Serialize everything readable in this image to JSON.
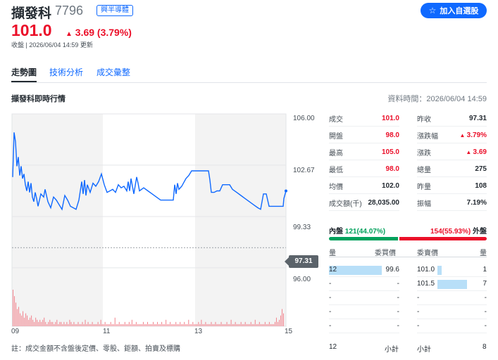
{
  "header": {
    "name": "擷發科",
    "code": "7796",
    "tag": "興半導體",
    "watchlist_label": "加入自選股",
    "price": "101.0",
    "change": "3.69 (3.79%)",
    "status": "收盤 | 2026/06/04 14:59 更新"
  },
  "tabs": [
    "走勢圖",
    "技術分析",
    "成交彙整"
  ],
  "section": {
    "title": "擷發科即時行情",
    "data_time": "資料時間：2026/06/04 14:59"
  },
  "chart_data": {
    "type": "line",
    "y_axis_labels": [
      "106.00",
      "102.67",
      "99.33",
      "96.00"
    ],
    "ylim": [
      94.9,
      106.0
    ],
    "x_axis_labels": [
      "09",
      "11",
      "13",
      "15"
    ],
    "prev_close": "97.31",
    "prev_close_value": 97.31,
    "price_series": [
      [
        0,
        101.9
      ],
      [
        2,
        104.8
      ],
      [
        4,
        104.2
      ],
      [
        6,
        102.6
      ],
      [
        8,
        103.2
      ],
      [
        10,
        102.0
      ],
      [
        12,
        102.6
      ],
      [
        14,
        101.8
      ],
      [
        16,
        102.1
      ],
      [
        18,
        101.4
      ],
      [
        20,
        101.0
      ],
      [
        22,
        101.6
      ],
      [
        24,
        100.9
      ],
      [
        26,
        101.5
      ],
      [
        28,
        100.6
      ],
      [
        30,
        100.3
      ],
      [
        32,
        100.9
      ],
      [
        34,
        100.5
      ],
      [
        36,
        100.0
      ],
      [
        40,
        100.8
      ],
      [
        44,
        100.6
      ],
      [
        46,
        101.1
      ],
      [
        50,
        100.3
      ],
      [
        54,
        99.9
      ],
      [
        58,
        100.6
      ],
      [
        62,
        100.4
      ],
      [
        66,
        100.1
      ],
      [
        70,
        99.8
      ],
      [
        74,
        100.7
      ],
      [
        78,
        100.4
      ],
      [
        82,
        100.0
      ],
      [
        86,
        99.9
      ],
      [
        90,
        99.8
      ],
      [
        94,
        100.4
      ],
      [
        98,
        101.6
      ],
      [
        100,
        100.8
      ],
      [
        102,
        101.7
      ],
      [
        104,
        100.7
      ],
      [
        106,
        101.4
      ],
      [
        110,
        100.9
      ],
      [
        114,
        101.5
      ],
      [
        118,
        101.3
      ],
      [
        122,
        101.6
      ],
      [
        126,
        102.1
      ],
      [
        130,
        101.4
      ],
      [
        134,
        100.9
      ],
      [
        138,
        101.0
      ],
      [
        142,
        101.1
      ],
      [
        146,
        100.9
      ],
      [
        150,
        101.4
      ],
      [
        154,
        101.2
      ],
      [
        158,
        101.3
      ],
      [
        162,
        101.0
      ],
      [
        164,
        101.6
      ],
      [
        166,
        101.0
      ],
      [
        168,
        101.8
      ],
      [
        172,
        100.8
      ],
      [
        176,
        101.9
      ],
      [
        178,
        101.5
      ],
      [
        180,
        101.0
      ],
      [
        186,
        101.2
      ],
      [
        192,
        101.0
      ],
      [
        198,
        100.8
      ],
      [
        204,
        100.6
      ],
      [
        210,
        100.4
      ],
      [
        216,
        100.4
      ],
      [
        222,
        100.4
      ],
      [
        228,
        100.4
      ],
      [
        230,
        101.4
      ],
      [
        232,
        100.8
      ],
      [
        234,
        101.5
      ],
      [
        236,
        101.1
      ],
      [
        240,
        101.3
      ],
      [
        246,
        101.8
      ],
      [
        250,
        102.0
      ],
      [
        254,
        102.3
      ],
      [
        260,
        102.3
      ],
      [
        266,
        102.3
      ],
      [
        272,
        102.3
      ],
      [
        278,
        102.3
      ],
      [
        280,
        101.7
      ],
      [
        282,
        100.9
      ],
      [
        286,
        100.9
      ],
      [
        290,
        101.0
      ],
      [
        294,
        101.0
      ],
      [
        298,
        101.4
      ],
      [
        302,
        101.4
      ],
      [
        308,
        101.4
      ],
      [
        312,
        101.1
      ],
      [
        318,
        100.9
      ],
      [
        324,
        100.7
      ],
      [
        330,
        100.5
      ],
      [
        336,
        100.3
      ],
      [
        342,
        100.1
      ],
      [
        348,
        99.9
      ],
      [
        352,
        99.8
      ],
      [
        356,
        100.8
      ],
      [
        360,
        100.8
      ],
      [
        364,
        100.0
      ],
      [
        368,
        100.0
      ],
      [
        372,
        100.0
      ],
      [
        376,
        100.0
      ],
      [
        380,
        100.0
      ],
      [
        384,
        100.0
      ],
      [
        385,
        100.5
      ],
      [
        388,
        101.0
      ]
    ],
    "volume_series": [
      17,
      14,
      11,
      8,
      9,
      6,
      5,
      7,
      4,
      6,
      5,
      3,
      4,
      5,
      3,
      2,
      4,
      3,
      2,
      3,
      2,
      3,
      4,
      2,
      1,
      2,
      3,
      2,
      2,
      1,
      2,
      3,
      1,
      2,
      2,
      1,
      2,
      1,
      2,
      1,
      3,
      2,
      1,
      2,
      1,
      1,
      2,
      1,
      1,
      2,
      1,
      3,
      1,
      2,
      1,
      1,
      2,
      1,
      1,
      1,
      2,
      1,
      3,
      1,
      1,
      2,
      1,
      1,
      1,
      2,
      1,
      1,
      4,
      1,
      1,
      2,
      1,
      1,
      1,
      2,
      1,
      1,
      2,
      1,
      3,
      1,
      1,
      2,
      1,
      1,
      1,
      1,
      2,
      1,
      1,
      2,
      1,
      1,
      1,
      2,
      1,
      1,
      2,
      1,
      1,
      2,
      1,
      1,
      3,
      1,
      1,
      2,
      1,
      1,
      1,
      2,
      1,
      1,
      2,
      1,
      1,
      2,
      1,
      1,
      3,
      1,
      1,
      2,
      1,
      1,
      1,
      2,
      1,
      3,
      1,
      1,
      2,
      1,
      1,
      1,
      2,
      1,
      1,
      2,
      1,
      1,
      1,
      2,
      1,
      1,
      1,
      2,
      1,
      1,
      3,
      1,
      1,
      2,
      1,
      1,
      1,
      2,
      1,
      1,
      2,
      1,
      1,
      1,
      2,
      1,
      1,
      3,
      1,
      1,
      2,
      1,
      1,
      1,
      2,
      1,
      1,
      2,
      1,
      1,
      1,
      2,
      4,
      2,
      3,
      5,
      8,
      6
    ],
    "footnote": "註：成交金額不含盤後定價、零股、鉅額、拍賣及標購"
  },
  "quote": {
    "left": [
      {
        "label": "成交",
        "value": "101.0",
        "color": "red"
      },
      {
        "label": "開盤",
        "value": "98.0",
        "color": "red"
      },
      {
        "label": "最高",
        "value": "105.0",
        "color": "red"
      },
      {
        "label": "最低",
        "value": "98.0",
        "color": "red"
      },
      {
        "label": "均價",
        "value": "102.0",
        "color": "dark"
      },
      {
        "label": "成交額(千)",
        "value": "28,035.00",
        "color": "dark"
      }
    ],
    "right": [
      {
        "label": "昨收",
        "value": "97.31",
        "color": "dark"
      },
      {
        "label": "漲跌幅",
        "value": "3.79%",
        "color": "red",
        "arrow": true
      },
      {
        "label": "漲跌",
        "value": "3.69",
        "color": "red",
        "arrow": true
      },
      {
        "label": "總量",
        "value": "275",
        "color": "dark"
      },
      {
        "label": "昨量",
        "value": "108",
        "color": "dark"
      },
      {
        "label": "振幅",
        "value": "7.19%",
        "color": "dark"
      }
    ]
  },
  "inout": {
    "in_label": "內盤",
    "in_value": "121(44.07%)",
    "in_fraction": 0.4407,
    "out_label": "外盤",
    "out_value": "154(55.93%)"
  },
  "orderbook": {
    "headers": {
      "bid_qty": "量",
      "bid_price": "委買價",
      "ask_price": "委賣價",
      "ask_qty": "量"
    },
    "bids": [
      {
        "qty": "12",
        "price": "99.6",
        "fraction": 1.0
      },
      {
        "qty": "-",
        "price": "-",
        "fraction": 0
      },
      {
        "qty": "-",
        "price": "-",
        "fraction": 0
      },
      {
        "qty": "-",
        "price": "-",
        "fraction": 0
      },
      {
        "qty": "-",
        "price": "-",
        "fraction": 0
      }
    ],
    "asks": [
      {
        "price": "101.0",
        "qty": "1",
        "fraction": 0.143
      },
      {
        "price": "101.5",
        "qty": "7",
        "fraction": 1.0
      },
      {
        "price": "-",
        "qty": "-",
        "fraction": 0
      },
      {
        "price": "-",
        "qty": "-",
        "fraction": 0
      },
      {
        "price": "-",
        "qty": "-",
        "fraction": 0
      }
    ],
    "bid_total": "12",
    "bid_total_label": "小計",
    "ask_total_label": "小計",
    "ask_total": "8"
  },
  "colors": {
    "up": "#eb0f29",
    "down": "#00a15c",
    "line": "#0f69ff",
    "accent": "#0f69ff"
  },
  "icons": {
    "watchlist": "star-icon",
    "change": "triangle-up-icon"
  }
}
